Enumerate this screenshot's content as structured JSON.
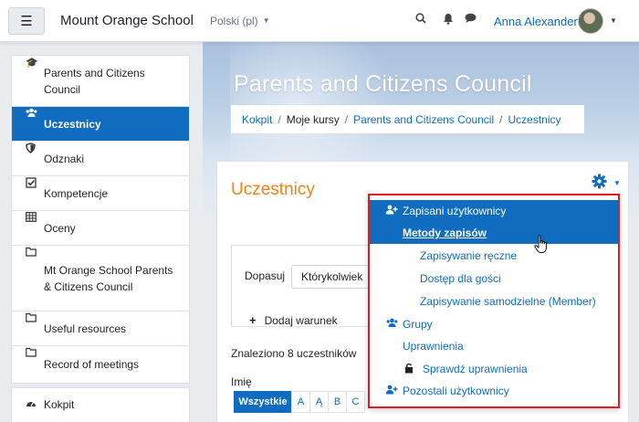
{
  "navbar": {
    "menu_icon": "hamburger-icon",
    "site_name": "Mount Orange School",
    "language": "Polski (pl)",
    "icons": [
      "search-icon",
      "bell-icon",
      "chat-icon"
    ],
    "user_name": "Anna Alexander"
  },
  "sidebar": {
    "items": [
      {
        "icon": "graduation-cap-icon",
        "label": "Parents and Citizens Council"
      },
      {
        "icon": "users-icon",
        "label": "Uczestnicy",
        "active": true
      },
      {
        "icon": "shield-icon",
        "label": "Odznaki"
      },
      {
        "icon": "checkbox-icon",
        "label": "Kompetencje"
      },
      {
        "icon": "table-icon",
        "label": "Oceny"
      },
      {
        "icon": "folder-icon",
        "label": "Mt Orange School Parents & Citizens Council"
      },
      {
        "icon": "folder-icon",
        "label": "Useful resources"
      },
      {
        "icon": "folder-icon",
        "label": "Record of meetings"
      }
    ],
    "dashboard": {
      "icon": "dashboard-icon",
      "label": "Kokpit"
    }
  },
  "header": {
    "title": "Parents and Citizens Council",
    "breadcrumb": [
      {
        "label": "Kokpit",
        "link": true
      },
      {
        "label": "Moje kursy",
        "link": false
      },
      {
        "label": "Parents and Citizens Council",
        "link": true
      },
      {
        "label": "Uczestnicy",
        "link": true
      }
    ]
  },
  "main": {
    "title": "Uczestnicy",
    "filter": {
      "match_label": "Dopasuj",
      "match_value": "Którykolwiek",
      "add_condition": "Dodaj warunek"
    },
    "found_text": "Znaleziono 8 uczestników",
    "first_name_label": "Imię",
    "letters": [
      "Wszystkie",
      "A",
      "Ą",
      "B",
      "C"
    ]
  },
  "dropdown": {
    "items": [
      {
        "label": "Zapisani użytkownicy",
        "icon": "user-plus-icon"
      },
      {
        "label": "Metody zapisów"
      },
      {
        "label": "Zapisywanie ręczne"
      },
      {
        "label": "Dostęp dla gości"
      },
      {
        "label": "Zapisywanie samodzielne (Member)"
      },
      {
        "label": "Grupy",
        "icon": "users-icon"
      },
      {
        "label": "Uprawnienia"
      },
      {
        "label": "Sprawdź uprawnienia",
        "icon": "lock-icon"
      },
      {
        "label": "Pozostali użytkownicy",
        "icon": "user-plus-icon"
      }
    ]
  },
  "colors": {
    "primary": "#0f6cbf",
    "title_orange": "#f98012",
    "highlight_border": "#e01b22"
  }
}
